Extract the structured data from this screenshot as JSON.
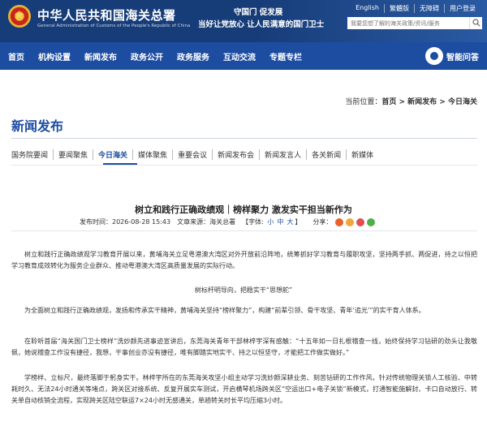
{
  "header": {
    "org_name": "中华人民共和国海关总署",
    "org_en": "General Administration of Customs of the People's Republic of China",
    "slogan1": "守国门  促发展",
    "slogan2": "当好让党放心  让人民满意的国门卫士",
    "top_links": [
      "English",
      "繁體版",
      "无障碍",
      "用户登录"
    ],
    "search_placeholder": "我要您想了解的海关政策/资讯/服务"
  },
  "nav": {
    "items": [
      "首页",
      "机构设置",
      "新闻发布",
      "政务公开",
      "政务服务",
      "互动交流",
      "专题专栏"
    ],
    "assistant": "智能问答"
  },
  "breadcrumb": {
    "prefix": "当前位置：",
    "home": "首页",
    "sep1": " > ",
    "section": "新闻发布",
    "sep2": " > ",
    "current": "今日海关"
  },
  "section_title": "新闻发布",
  "tabs": [
    "国务院要闻",
    "要闻聚焦",
    "今日海关",
    "媒体聚焦",
    "重要会议",
    "新闻发布会",
    "新闻发言人",
    "各关新闻",
    "新媒体"
  ],
  "article": {
    "title": "树立和践行正确政绩观｜榜样聚力 激发实干担当新作为",
    "publish_label": "发布时间：",
    "publish_time": "2026-08-28 15:43",
    "source_label": "文章来源：",
    "source": "海关总署",
    "fontsize_label": "【字体:",
    "fs_small": "小",
    "fs_mid": "中",
    "fs_large": "大",
    "fontsize_end": "】",
    "share_label": "分享：",
    "share_colors": [
      "#e8612c",
      "#f2a53a",
      "#e34e4e",
      "#4fb04a"
    ],
    "paragraphs": [
      "树立和践行正确政绩观学习教育开展以来，黄埔海关立足粤港澳大湾区对外开放前沿阵地，统筹抓好学习教育与履职攻坚，坚持两手抓、两促进，持之以恒把学习教育成效转化为服务企业群众、推动粤港澳大湾区高质量发展的实际行动。",
      "树标杆明导向，把稳实干“思想舵”",
      "为全面树立和践行正确政绩观，发扬和传承实干精神，黄埔海关坚持“榜样聚力”，构建“前辈引领、骨干攻坚、青年‘追光’”的实干育人体系。",
      "在聆听首届“海关国门卫士榜样”洗妙颜先进事迹宣讲后，东莞海关青年干部林梓宇深有感触：“十五年如一日扎根稽查一线，始终保持学习钻研的劲头让我敬佩，她说稽查工作没有捷径，我想，干事创业亦没有捷径，唯有脚踏实地实干、持之以恒坚守，才能把工作做实做好。”",
      "学榜样、立标尺，最终落脚于躬身实干。林梓宇所在的东莞海关攻坚小组主动学习洗妙颜深耕业务、刻苦钻研的工作作风，针对传统物理关锁人工核验、中转耗时久、无法24小时通关等堵点，跨关区对接系统、反复开展实车测试，开启横琴机场跨关区“空运出口+电子关锁”新模式，打通智能施解封、卡口自动放行、转关单自动核销全流程，实现跨关区陆空联运7×24小时无感通关，单趟转关时长平均压缩3小时。"
    ]
  }
}
